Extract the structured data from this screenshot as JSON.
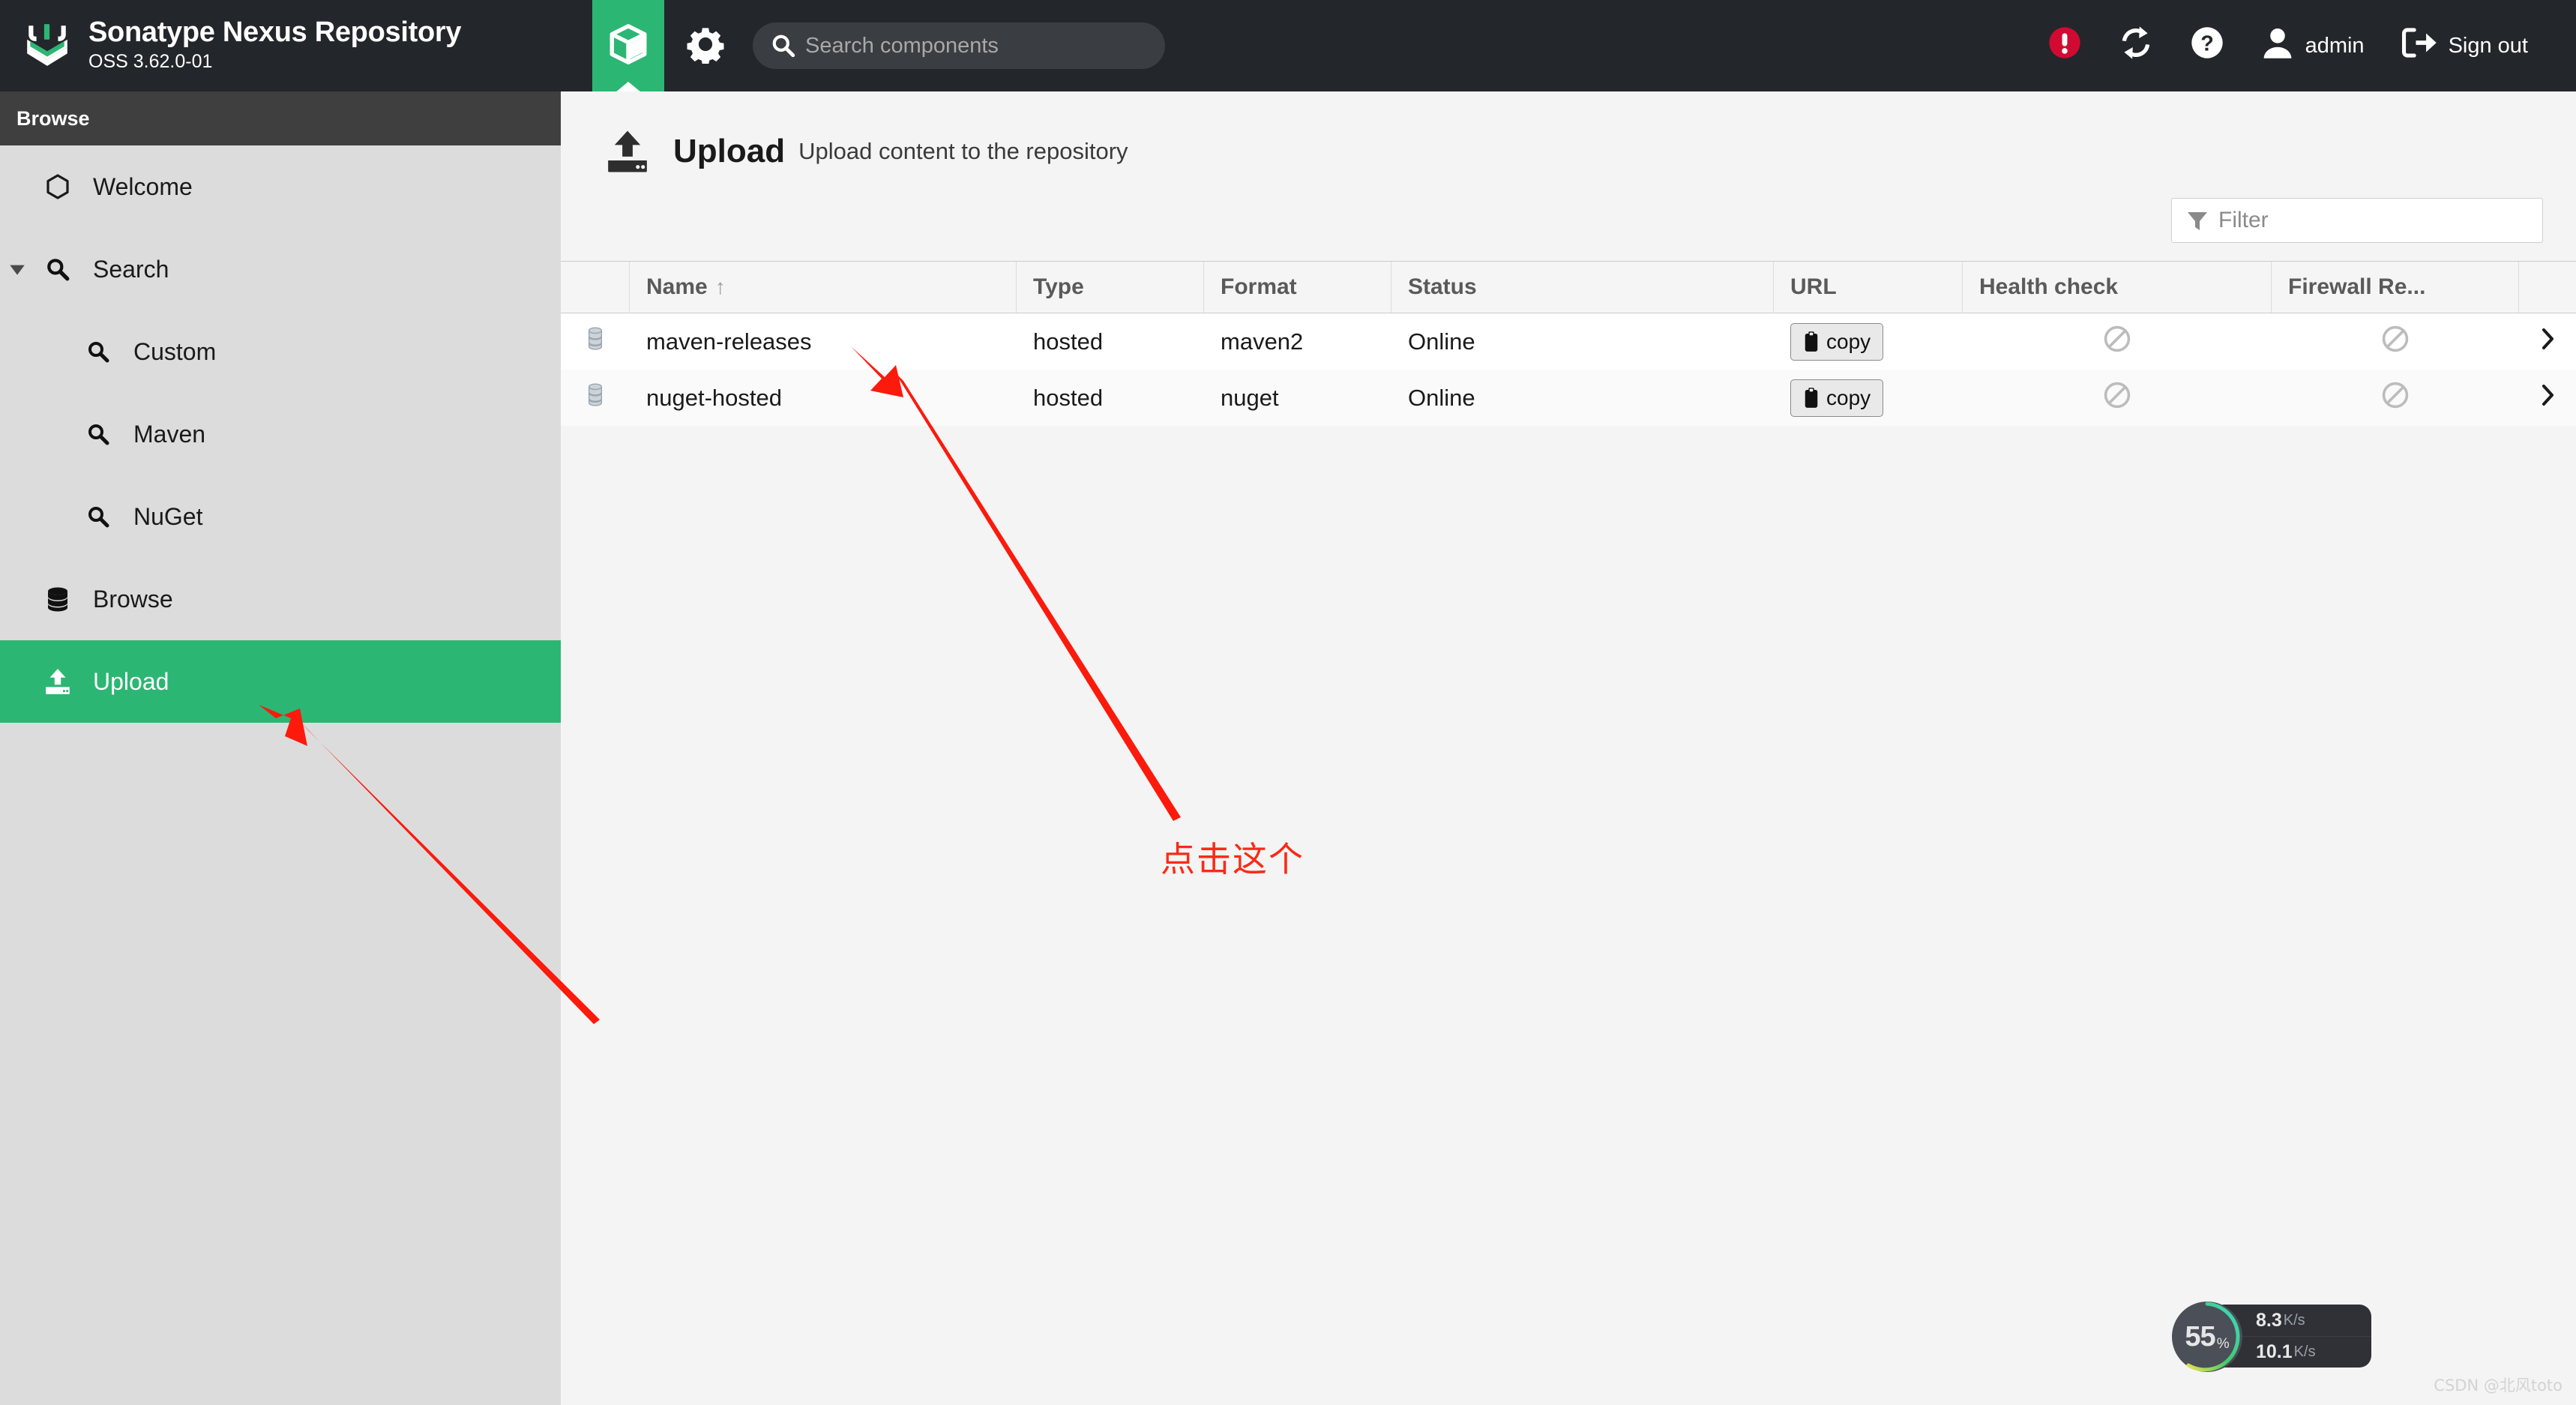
{
  "header": {
    "brand_title": "Sonatype Nexus Repository",
    "brand_subtitle": "OSS 3.62.0-01",
    "brand_logo_icon": "nexus-chevron-logo",
    "tab_icon": "cube-icon",
    "gear_icon": "gear-icon",
    "search": {
      "icon": "search-icon",
      "placeholder": "Search components",
      "value": ""
    },
    "alert_icon": "alert-circle-icon",
    "refresh_icon": "refresh-icon",
    "help_icon": "help-circle-icon",
    "user_icon": "user-icon",
    "user_label": "admin",
    "signout_icon": "sign-out-icon",
    "signout_label": "Sign out"
  },
  "sidebar": {
    "title": "Browse",
    "items": [
      {
        "label": "Welcome",
        "icon": "hexagon-icon",
        "level": 0,
        "caret": false,
        "active": false
      },
      {
        "label": "Search",
        "icon": "search-icon",
        "level": 0,
        "caret": true,
        "active": false
      },
      {
        "label": "Custom",
        "icon": "search-icon",
        "level": 1,
        "caret": false,
        "active": false
      },
      {
        "label": "Maven",
        "icon": "search-icon",
        "level": 1,
        "caret": false,
        "active": false
      },
      {
        "label": "NuGet",
        "icon": "search-icon",
        "level": 1,
        "caret": false,
        "active": false
      },
      {
        "label": "Browse",
        "icon": "database-icon",
        "level": 0,
        "caret": false,
        "active": false
      },
      {
        "label": "Upload",
        "icon": "upload-icon",
        "level": 0,
        "caret": false,
        "active": true
      }
    ]
  },
  "page": {
    "icon": "upload-icon",
    "title": "Upload",
    "description": "Upload content to the repository"
  },
  "filter": {
    "icon": "funnel-icon",
    "placeholder": "Filter",
    "value": ""
  },
  "table": {
    "columns": [
      {
        "key": "select",
        "label": ""
      },
      {
        "key": "name",
        "label": "Name",
        "sort": "↑"
      },
      {
        "key": "type",
        "label": "Type"
      },
      {
        "key": "format",
        "label": "Format"
      },
      {
        "key": "status",
        "label": "Status"
      },
      {
        "key": "url",
        "label": "URL"
      },
      {
        "key": "health",
        "label": "Health check"
      },
      {
        "key": "firewall",
        "label": "Firewall Re..."
      },
      {
        "key": "arrow",
        "label": ""
      }
    ],
    "copy_label": "copy",
    "copy_icon": "clipboard-icon",
    "row_icon": "repository-icon",
    "health_icon": "prohibited-icon",
    "firewall_icon": "prohibited-icon",
    "row_chevron_icon": "chevron-right-icon",
    "rows": [
      {
        "name": "maven-releases",
        "type": "hosted",
        "format": "maven2",
        "status": "Online"
      },
      {
        "name": "nuget-hosted",
        "type": "hosted",
        "format": "nuget",
        "status": "Online"
      }
    ]
  },
  "annotations": {
    "note_text": "点击这个",
    "arrow_color": "#fb2a16"
  },
  "net_widget": {
    "cpu_percent": "55",
    "percent_symbol": "%",
    "upload_arrow": "↑",
    "upload_value": "8.3",
    "upload_unit": "K/s",
    "download_arrow": "↓",
    "download_value": "10.1",
    "download_unit": "K/s",
    "upload_color": "#3fa9f5",
    "download_color": "#3ec46d"
  },
  "watermark": "CSDN @北风toto",
  "colors": {
    "brand_green": "#2cb673",
    "header_dark": "#23262a",
    "sidebar_bg": "#dcdcdc",
    "alert_red": "#d10a32"
  }
}
